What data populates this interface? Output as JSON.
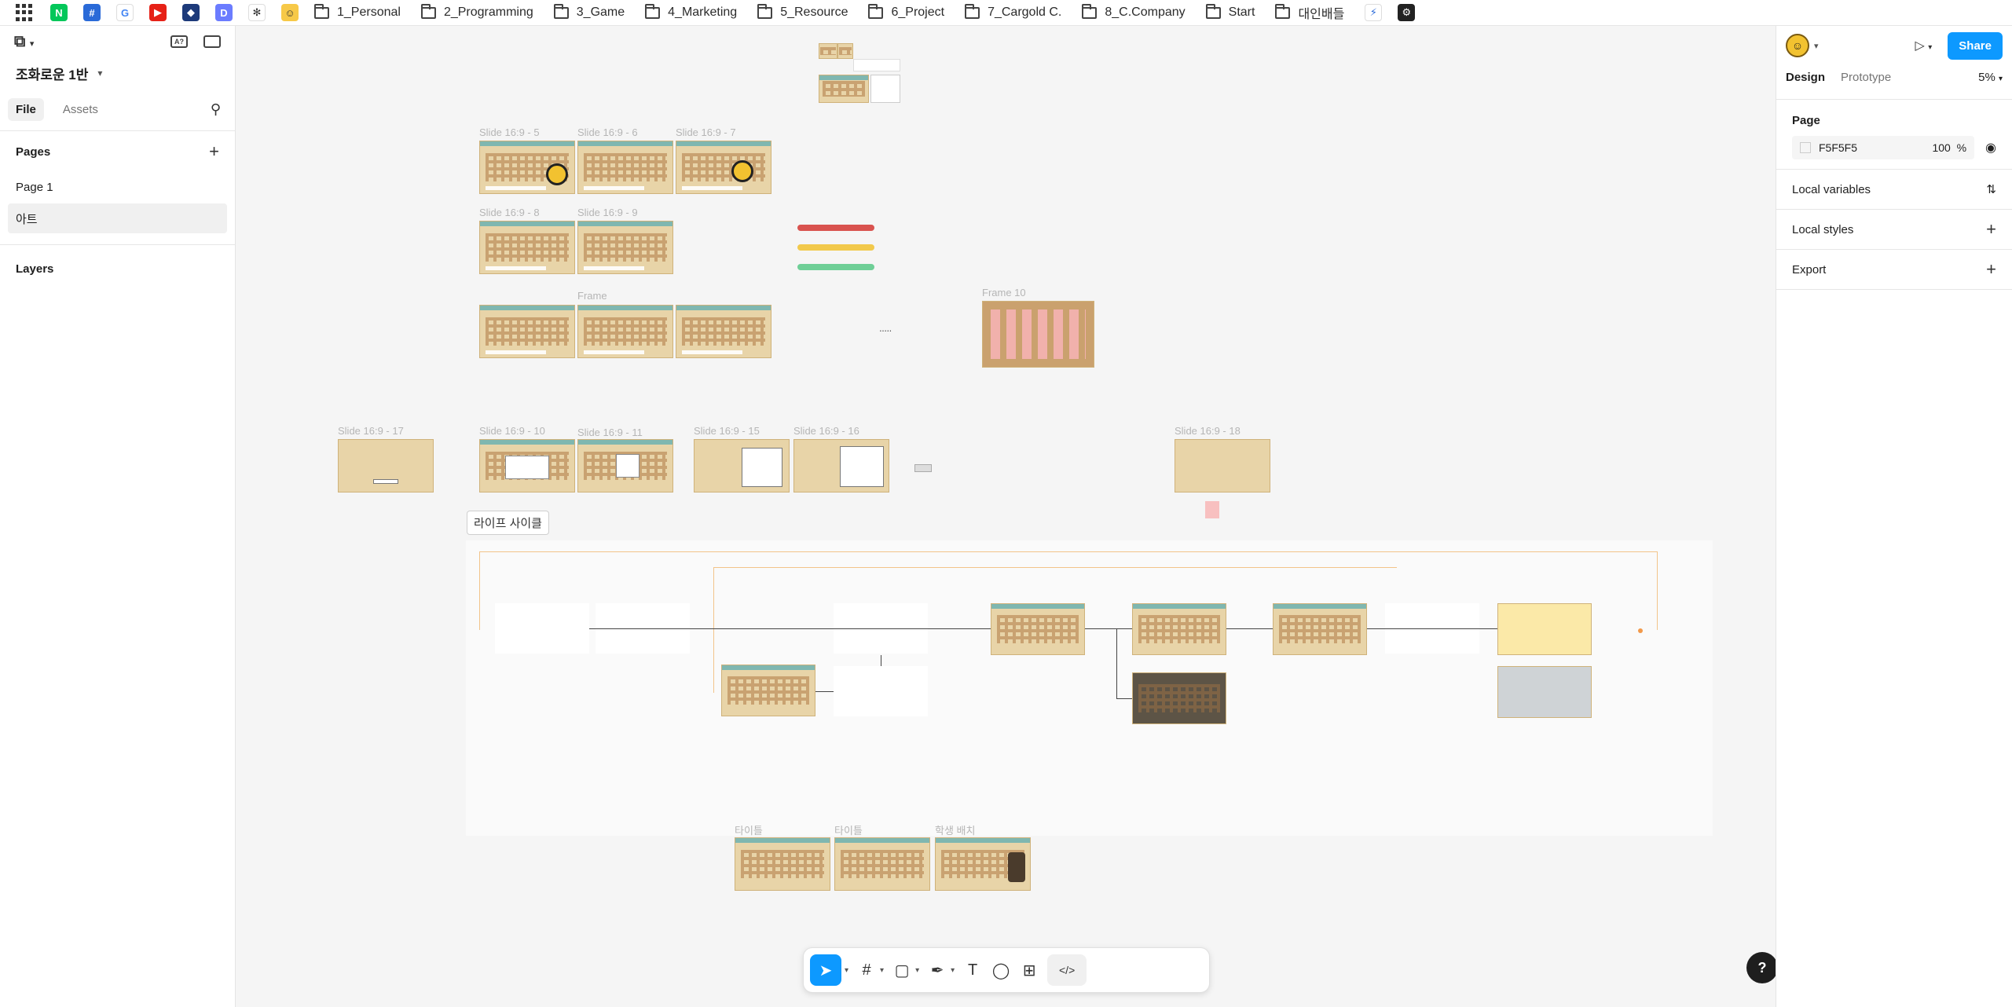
{
  "bookmarks": {
    "folders": [
      "1_Personal",
      "2_Programming",
      "3_Game",
      "4_Marketing",
      "5_Resource",
      "6_Project",
      "7_Cargold C.",
      "8_C.Company",
      "Start",
      "대인배들"
    ]
  },
  "left": {
    "file_title": "조화로운 1반",
    "tabs": [
      "File",
      "Assets"
    ],
    "pages_header": "Pages",
    "pages": [
      "Page 1",
      "아트"
    ],
    "layers_header": "Layers"
  },
  "right": {
    "share": "Share",
    "tabs": [
      "Design",
      "Prototype"
    ],
    "zoom": "5%",
    "page_header": "Page",
    "fill_hex": "F5F5F5",
    "fill_opacity": "100",
    "fill_pct": "%",
    "local_variables": "Local variables",
    "local_styles": "Local styles",
    "export": "Export"
  },
  "canvas": {
    "slide_labels": [
      "Slide 16:9 - 5",
      "Slide 16:9 - 6",
      "Slide 16:9 - 7",
      "Slide 16:9 - 8",
      "Slide 16:9 - 9",
      "Frame",
      "Frame 10",
      "Slide 16:9 - 17",
      "Slide 16:9 - 10",
      "Slide 16:9 - 11",
      "Slide 16:9 - 15",
      "Slide 16:9 - 16",
      "Slide 16:9 - 18",
      "타이틀",
      "타이틀",
      "학생 배치"
    ],
    "lifecycle_label": "라이프 사이클"
  },
  "colors": {
    "accent": "#0d99ff",
    "canvas_bg": "#f5f5f5"
  }
}
